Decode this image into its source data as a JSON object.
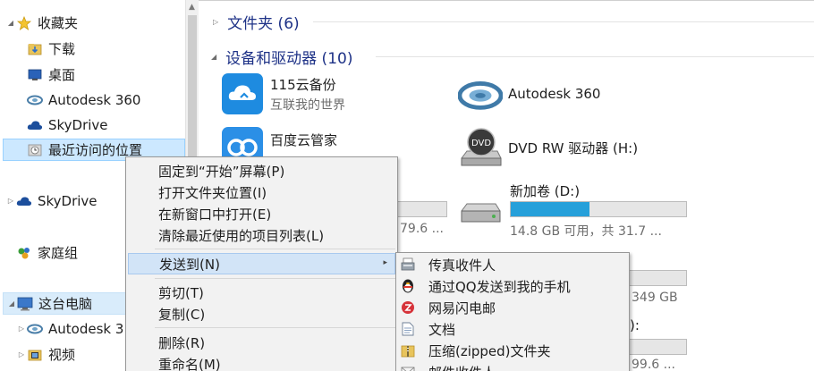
{
  "nav": {
    "items": [
      {
        "label": "收藏夹",
        "icon": "star-icon"
      },
      {
        "label": "下载",
        "icon": "downloads-folder-icon"
      },
      {
        "label": "桌面",
        "icon": "desktop-icon"
      },
      {
        "label": "Autodesk 360",
        "icon": "autodesk-360-icon"
      },
      {
        "label": "SkyDrive",
        "icon": "skydrive-cloud-icon"
      },
      {
        "label": "最近访问的位置",
        "icon": "recent-places-icon"
      },
      {
        "label": "SkyDrive",
        "icon": "skydrive-cloud-icon"
      },
      {
        "label": "家庭组",
        "icon": "homegroup-icon"
      },
      {
        "label": "这台电脑",
        "icon": "this-pc-icon"
      },
      {
        "label": "Autodesk 3",
        "icon": "autodesk-360-icon"
      },
      {
        "label": "视频",
        "icon": "videos-folder-icon"
      }
    ]
  },
  "content": {
    "folders_header": "文件夹 (6)",
    "devices_header": "设备和驱动器 (10)",
    "tiles": {
      "baidu115": {
        "name": "115云备份",
        "sub": "互联我的世界"
      },
      "autodesk": {
        "name": "Autodesk 360"
      },
      "baiduyun": {
        "name": "百度云管家"
      },
      "dvd": {
        "name": "DVD RW 驱动器 (H:)"
      },
      "drive_d": {
        "name": "新加卷 (D:)",
        "caption": "14.8 GB 可用，共 31.7 ...",
        "used_fraction": 0.45
      },
      "partial_left_caption": "79.6 ...",
      "partial_right_caption": "349 GB",
      "partial_right_paren": "):",
      "partial_bottom_caption": "99.6 ..."
    }
  },
  "menu": {
    "items": [
      {
        "label": "固定到“开始”屏幕(P)"
      },
      {
        "label": "打开文件夹位置(I)"
      },
      {
        "label": "在新窗口中打开(E)"
      },
      {
        "label": "清除最近使用的项目列表(L)"
      },
      {
        "label": "发送到(N)"
      },
      {
        "label": "剪切(T)"
      },
      {
        "label": "复制(C)"
      },
      {
        "label": "删除(R)"
      },
      {
        "label": "重命名(M)"
      }
    ],
    "arrow": "▸"
  },
  "submenu": {
    "items": [
      {
        "label": "传真收件人",
        "icon": "fax-icon"
      },
      {
        "label": "通过QQ发送到我的手机",
        "icon": "qq-penguin-icon"
      },
      {
        "label": "网易闪电邮",
        "icon": "netease-mail-icon"
      },
      {
        "label": "文档",
        "icon": "document-icon"
      },
      {
        "label": "压缩(zipped)文件夹",
        "icon": "zip-folder-icon"
      },
      {
        "label": "邮件收件人",
        "icon": "mail-recipient-icon"
      }
    ]
  },
  "colors": {
    "selection": "#cce8ff",
    "menu_highlight": "#d2e4f7",
    "header_blue": "#1e3287",
    "bar_fill": "#26a0da"
  }
}
